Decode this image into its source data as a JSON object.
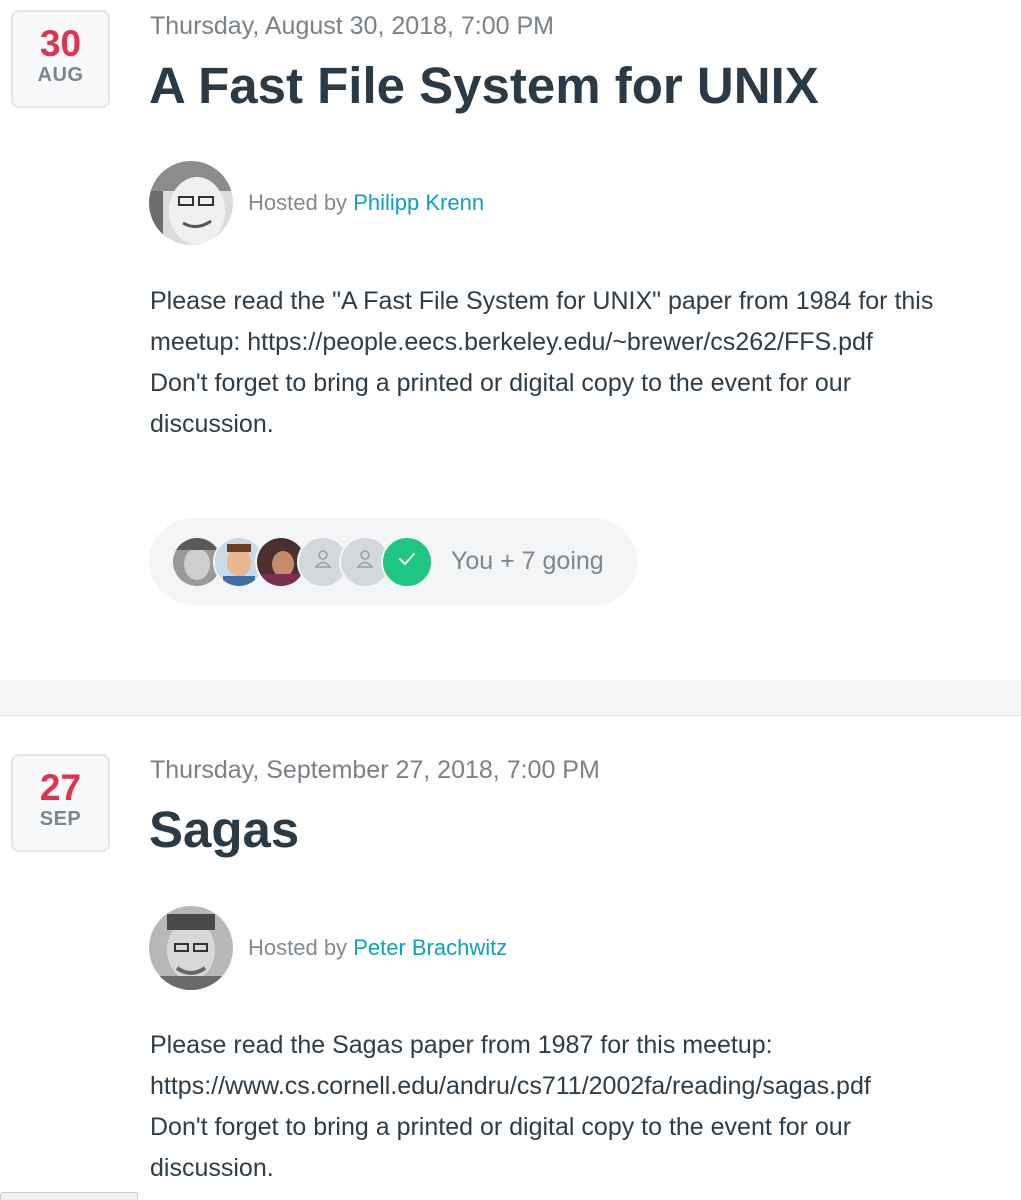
{
  "events": [
    {
      "day": "30",
      "month": "AUG",
      "datetime": "Thursday, August 30, 2018, 7:00 PM",
      "title": "A Fast File System for UNIX",
      "host_prefix": "Hosted by",
      "host_name": "Philipp Krenn",
      "description": [
        "Please read the \"A Fast File System for UNIX\" paper from 1984 for this",
        "meetup: https://people.eecs.berkeley.edu/~brewer/cs262/FFS.pdf",
        "Don't forget to bring a printed or digital copy to the event for our",
        "discussion."
      ],
      "attendance": "You + 7 going"
    },
    {
      "day": "27",
      "month": "SEP",
      "datetime": "Thursday, September 27, 2018, 7:00 PM",
      "title": "Sagas",
      "host_prefix": "Hosted by",
      "host_name": "Peter Brachwitz",
      "description": [
        "Please read the Sagas paper from 1987 for this meetup:",
        "https://www.cs.cornell.edu/andru/cs711/2002fa/reading/sagas.pdf",
        "Don't forget to bring a printed or digital copy to the event for our",
        "discussion."
      ]
    }
  ],
  "colors": {
    "date_day": "#e0334f",
    "link": "#0e9fc3",
    "going_check": "#1fc683",
    "title": "#2b3a45"
  },
  "icons": {
    "attendee_placeholder": "user-outline-icon",
    "going": "checkmark-icon"
  }
}
